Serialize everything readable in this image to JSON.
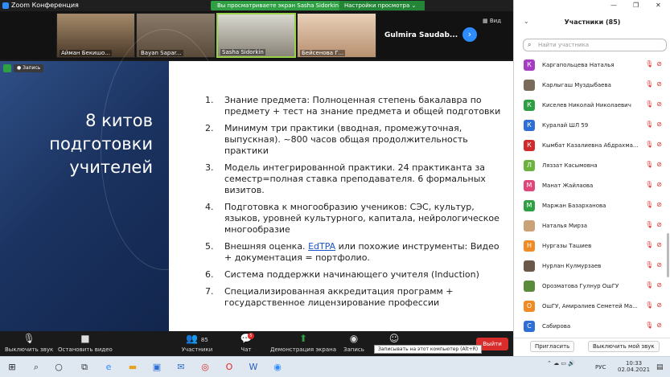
{
  "window": {
    "title": "Zoom Конференция"
  },
  "share_bar": {
    "viewing": "Вы просматриваете экран Sasha Sidorkin",
    "view_settings": "Настройки просмотра ⌄"
  },
  "video_strip": {
    "tiles": [
      {
        "name": "Айман Бекишо..."
      },
      {
        "name": "Bayan Sapar..."
      },
      {
        "name": "Sasha Sidorkin"
      },
      {
        "name": "Бейсенова Г..."
      }
    ],
    "gulmira": "Gulmira Saudab...",
    "view_label": "Вид"
  },
  "recording": {
    "label": "Запись"
  },
  "slide": {
    "title_lines": [
      "8 китов",
      "подготовки",
      "учителей"
    ],
    "items": [
      {
        "num": "1.",
        "text": "Знание предмета: Полноценная степень бакалавра по предмету + тест на знание предмета и общей подготовки"
      },
      {
        "num": "2.",
        "text": "Минимум три практики (вводная, промежуточная, выпускная). ~800 часов общая продолжительность практики"
      },
      {
        "num": "3.",
        "text": "Модель интегрированной практики. 24 практиканта за семестр=полная ставка преподавателя. 6 формальных визитов."
      },
      {
        "num": "4.",
        "text": "Подготовка к многообразию учеников: СЭС, культур, языков, уровней культурного, капитала, нейрологическое многообразие"
      },
      {
        "num": "5.",
        "pre": "Внешняя оценка. ",
        "link": "EdTPA",
        "post": " или похожие инструменты: Видео + документация = портфолио."
      },
      {
        "num": "6.",
        "text": "Система поддержки начинающего учителя (Induction)"
      },
      {
        "num": "7.",
        "text": "Специализированная аккредитация программ + государственное лицензирование профессии"
      }
    ]
  },
  "toolbar": {
    "mute": "Выключить звук",
    "video": "Остановить видео",
    "participants": "Участники",
    "participants_count": "85",
    "chat": "Чат",
    "chat_badge": "5",
    "share": "Демонстрация экрана",
    "record": "Запись",
    "end": "Выйти",
    "tooltip": "Записывать на этот компьютер (Alt+R)"
  },
  "panel": {
    "title": "Участники (85)",
    "search_placeholder": "Найти участника",
    "participants": [
      {
        "initial": "К",
        "color": "#a43dc2",
        "name": "Каргапольцева Наталья"
      },
      {
        "initial": "",
        "color": "#7a6a5a",
        "name": "Карлыгаш Муздыбаева"
      },
      {
        "initial": "К",
        "color": "#2ea043",
        "name": "Киселев Николай Николаевич"
      },
      {
        "initial": "К",
        "color": "#2d6fd6",
        "name": "Куралай ШЛ 59"
      },
      {
        "initial": "К",
        "color": "#d02a2a",
        "name": "Кымбат Казалиевна Абдрахма..."
      },
      {
        "initial": "Л",
        "color": "#6cb33e",
        "name": "Ляззат Касымовна"
      },
      {
        "initial": "М",
        "color": "#e0457b",
        "name": "Манат Жайлаова"
      },
      {
        "initial": "М",
        "color": "#2ea043",
        "name": "Маржан Базарханова"
      },
      {
        "initial": "",
        "color": "#c9a27a",
        "name": "Наталья Мирза"
      },
      {
        "initial": "Н",
        "color": "#f08a24",
        "name": "Нургазы Ташиев"
      },
      {
        "initial": "",
        "color": "#6b5848",
        "name": "Нурлан Кулмурзаев"
      },
      {
        "initial": "",
        "color": "#5a8a3a",
        "name": "Орозматова Гулнур ОшГУ"
      },
      {
        "initial": "О",
        "color": "#f08a24",
        "name": "ОшГУ, Амиралиев Семетей Ма..."
      },
      {
        "initial": "С",
        "color": "#2d6fd6",
        "name": "Сабирова"
      }
    ],
    "invite": "Пригласить",
    "mute_me": "Выключить мой звук"
  },
  "taskbar": {
    "lang": "РУС",
    "time": "10:33",
    "date": "02.04.2021"
  }
}
